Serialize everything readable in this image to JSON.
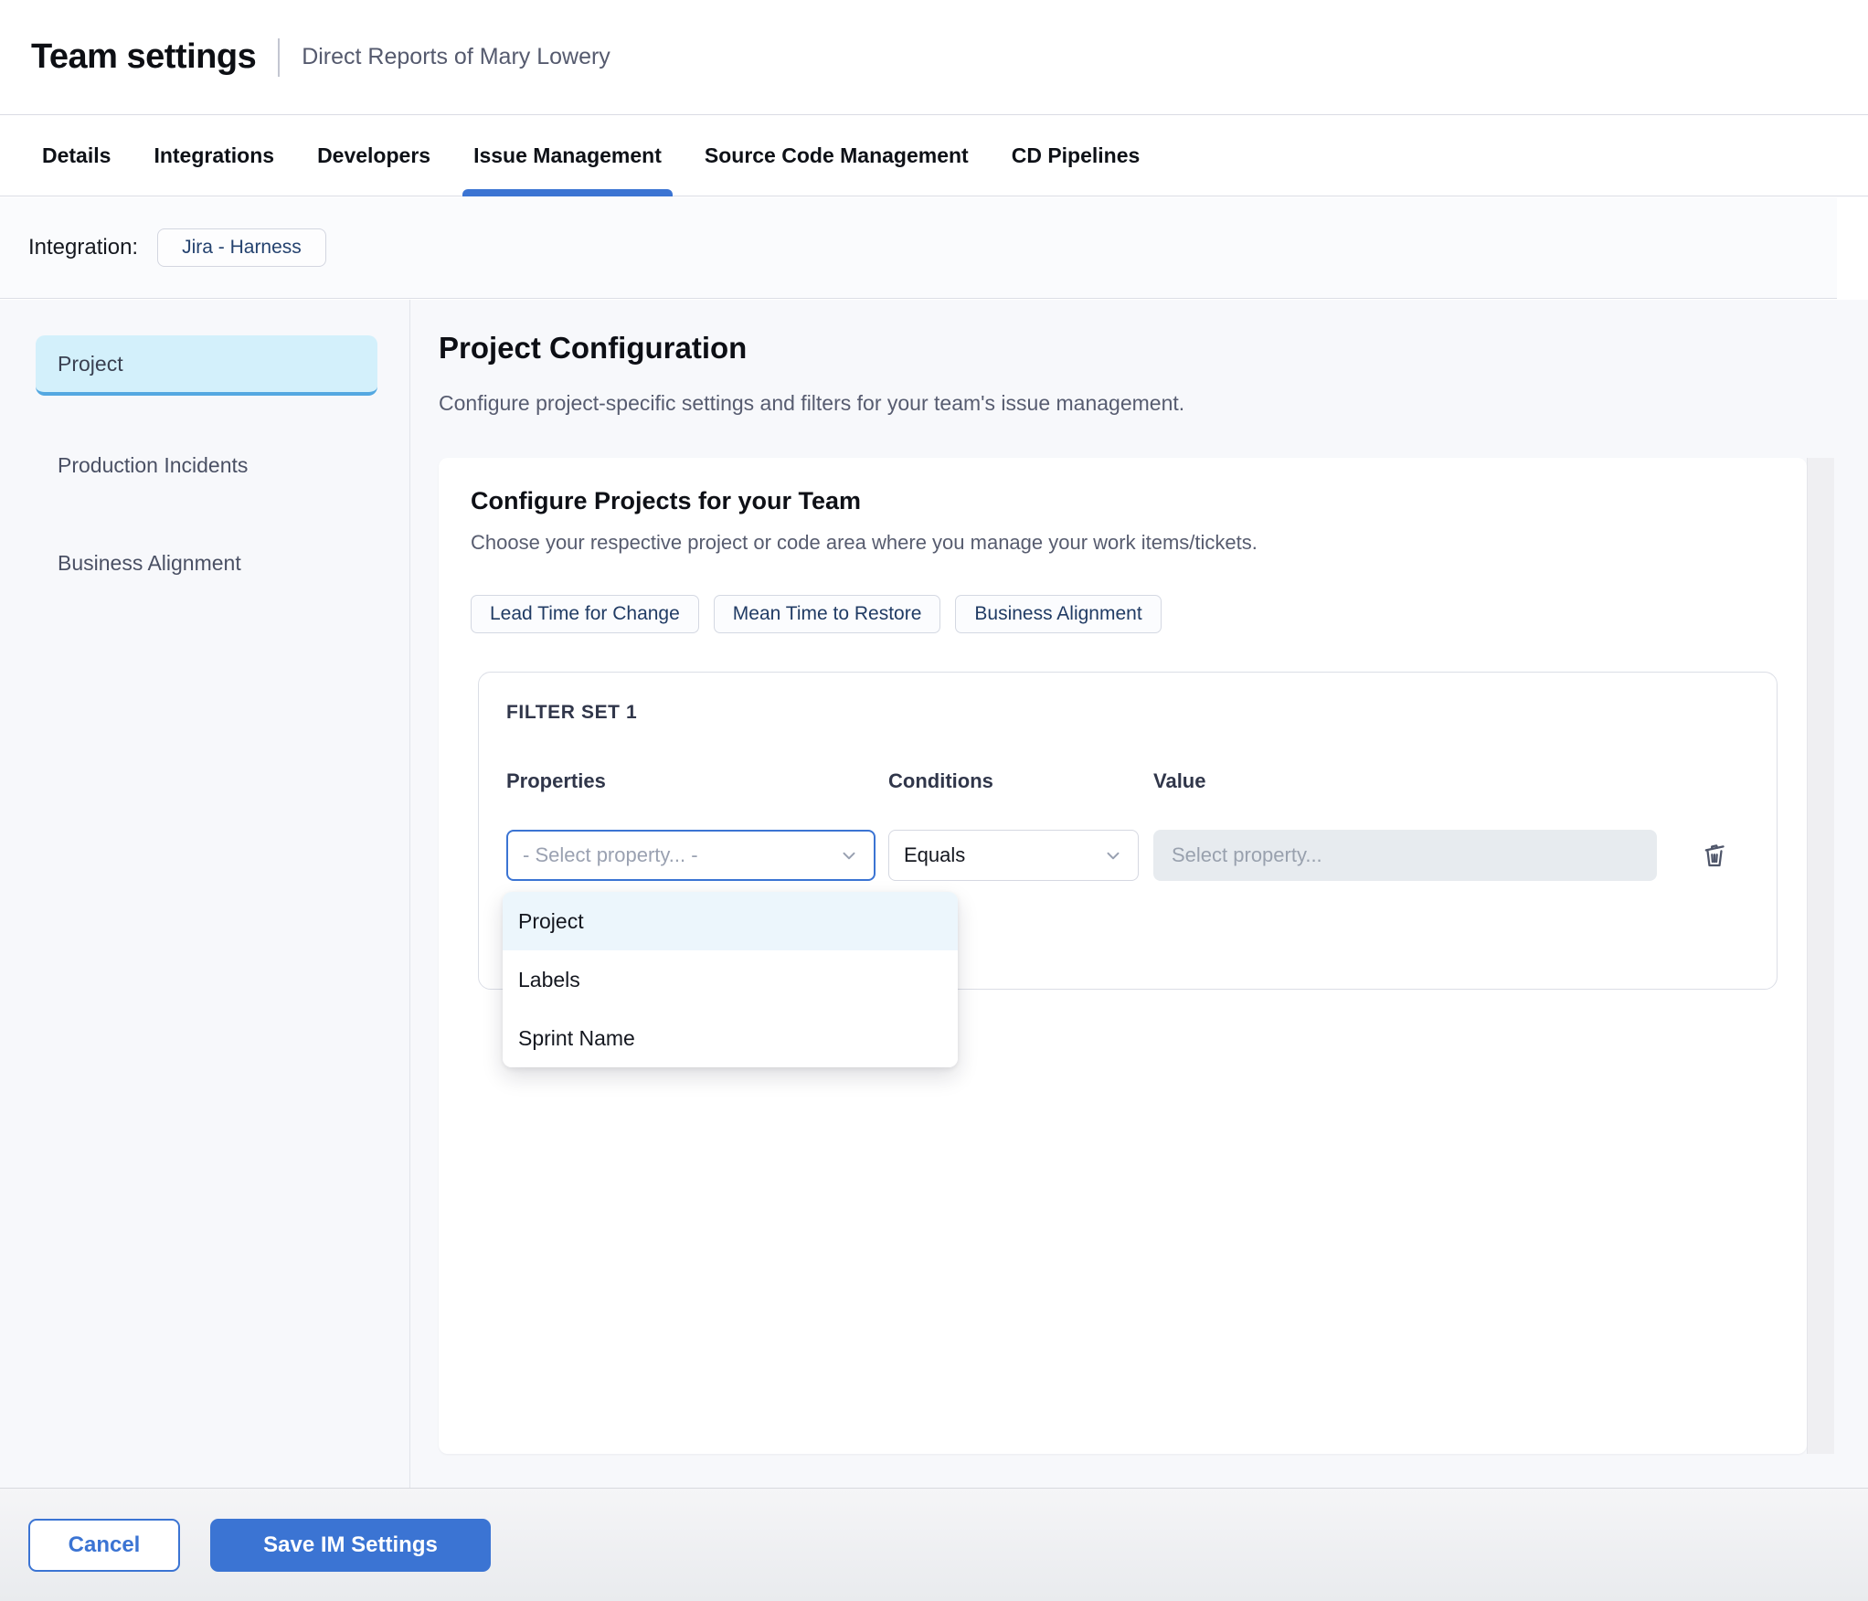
{
  "header": {
    "title": "Team settings",
    "subtitle": "Direct Reports of Mary Lowery"
  },
  "tabs": [
    {
      "label": "Details",
      "active": false
    },
    {
      "label": "Integrations",
      "active": false
    },
    {
      "label": "Developers",
      "active": false
    },
    {
      "label": "Issue Management",
      "active": true
    },
    {
      "label": "Source Code Management",
      "active": false
    },
    {
      "label": "CD Pipelines",
      "active": false
    }
  ],
  "integration": {
    "label": "Integration:",
    "chip": "Jira - Harness"
  },
  "sidebar": {
    "items": [
      {
        "label": "Project",
        "selected": true
      },
      {
        "label": "Production Incidents",
        "selected": false
      },
      {
        "label": "Business Alignment",
        "selected": false
      }
    ]
  },
  "main": {
    "title": "Project Configuration",
    "subtitle": "Configure project-specific settings and filters for your team's issue management.",
    "card": {
      "title": "Configure Projects for your Team",
      "subtitle": "Choose your respective project or code area where you manage your work items/tickets.",
      "chips": [
        "Lead Time for Change",
        "Mean Time to Restore",
        "Business Alignment"
      ],
      "filter_set": {
        "title": "FILTER SET 1",
        "columns": {
          "properties": "Properties",
          "conditions": "Conditions",
          "value": "Value"
        },
        "property_placeholder": "- Select property... -",
        "condition_value": "Equals",
        "value_placeholder": "Select property...",
        "dropdown_options": [
          {
            "label": "Project",
            "highlighted": true
          },
          {
            "label": "Labels",
            "highlighted": false
          },
          {
            "label": "Sprint Name",
            "highlighted": false
          }
        ]
      }
    }
  },
  "footer": {
    "cancel_label": "Cancel",
    "save_label": "Save IM Settings"
  },
  "colors": {
    "accent_blue": "#3b74d3",
    "sidebar_selected_bg": "#d3f0fb",
    "sidebar_selected_border": "#54a8e1",
    "dropdown_highlight_bg": "#ecf6fc",
    "disabled_input_bg": "#e7ebef"
  }
}
